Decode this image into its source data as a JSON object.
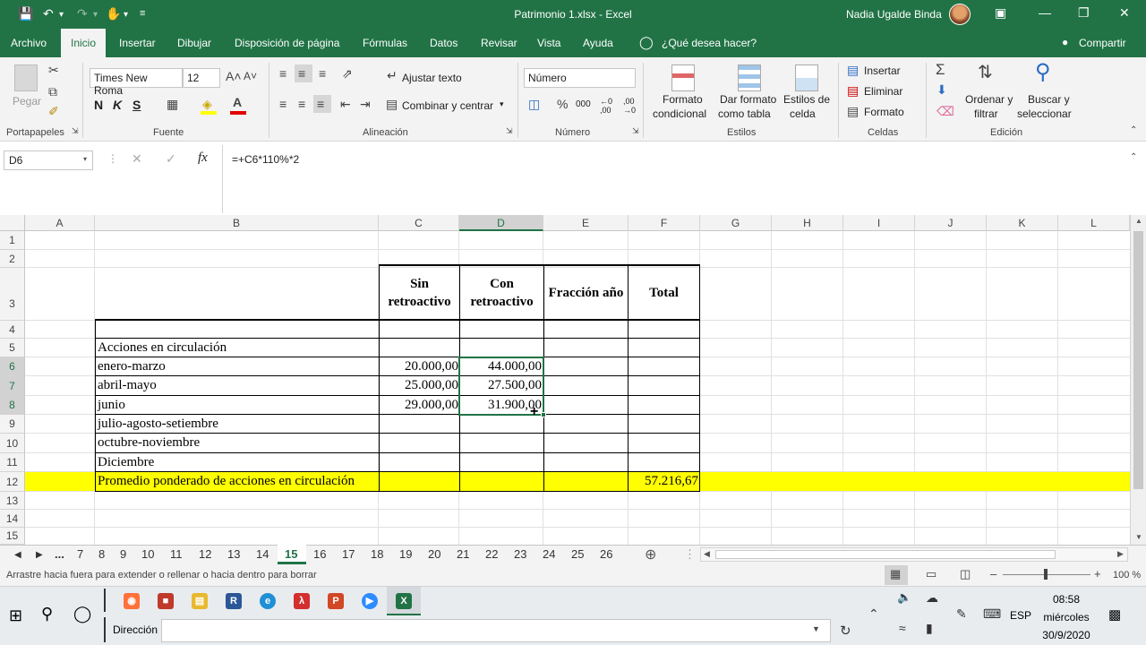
{
  "titlebar": {
    "title": "Patrimonio 1.xlsx  -  Excel",
    "user": "Nadia Ugalde Binda"
  },
  "tabs": [
    "Archivo",
    "Inicio",
    "Insertar",
    "Dibujar",
    "Disposición de página",
    "Fórmulas",
    "Datos",
    "Revisar",
    "Vista",
    "Ayuda"
  ],
  "tell_me": "¿Qué desea hacer?",
  "share": "Compartir",
  "ribbon": {
    "paste": "Pegar",
    "clipboard_label": "Portapapeles",
    "font_name": "Times New Roma",
    "font_size": "12",
    "font_label": "Fuente",
    "bold": "N",
    "italic": "K",
    "underline": "S",
    "wrap_text": "Ajustar texto",
    "merge_center": "Combinar y centrar",
    "alignment_label": "Alineación",
    "number_format": "Número",
    "number_label": "Número",
    "cond_format": [
      "Formato",
      "condicional"
    ],
    "table_format": [
      "Dar formato",
      "como tabla"
    ],
    "cell_styles": [
      "Estilos de",
      "celda"
    ],
    "styles_label": "Estilos",
    "insert": "Insertar",
    "delete": "Eliminar",
    "format": "Formato",
    "cells_label": "Celdas",
    "sort_filter": [
      "Ordenar y",
      "filtrar"
    ],
    "find_select": [
      "Buscar y",
      "seleccionar"
    ],
    "editing_label": "Edición"
  },
  "formula_bar": {
    "name_box": "D6",
    "formula": "=+C6*110%*2"
  },
  "columns": [
    "A",
    "B",
    "C",
    "D",
    "E",
    "F",
    "G",
    "H",
    "I",
    "J",
    "K",
    "L"
  ],
  "rows": [
    "1",
    "2",
    "3",
    "4",
    "5",
    "6",
    "7",
    "8",
    "9",
    "10",
    "11",
    "12",
    "13",
    "14",
    "15"
  ],
  "sheet": {
    "hdr_c": [
      "Sin",
      "retroactivo"
    ],
    "hdr_d": [
      "Con",
      "retroactivo"
    ],
    "hdr_e": "Fracción año",
    "hdr_f": "Total",
    "b5": "Acciones en circulación",
    "b6": "enero-marzo",
    "b7": "abril-mayo",
    "b8": "junio",
    "b9": "julio-agosto-setiembre",
    "b10": "octubre-noviembre",
    "b11": "Diciembre",
    "b12": "Promedio ponderado de acciones en circulación",
    "c6": "20.000,00",
    "c7": "25.000,00",
    "c8": "29.000,00",
    "d6": "44.000,00",
    "d7": "27.500,00",
    "d8": "31.900,00",
    "f12": "57.216,67",
    "highlight_color": "#ffff00"
  },
  "sheet_tabs": [
    "...",
    "7",
    "8",
    "9",
    "10",
    "11",
    "12",
    "13",
    "14",
    "15",
    "16",
    "17",
    "18",
    "19",
    "20",
    "21",
    "22",
    "23",
    "24",
    "25",
    "26"
  ],
  "active_sheet": "15",
  "status_text": "Arrastre hacia fuera para extender o rellenar o hacia dentro para borrar",
  "zoom": "100 %",
  "taskbar": {
    "address_label": "Dirección",
    "lang": "ESP",
    "time": "08:58",
    "day": "miércoles",
    "date": "30/9/2020"
  },
  "colors": {
    "excel_green": "#217346",
    "yellow": "#ffff00"
  }
}
